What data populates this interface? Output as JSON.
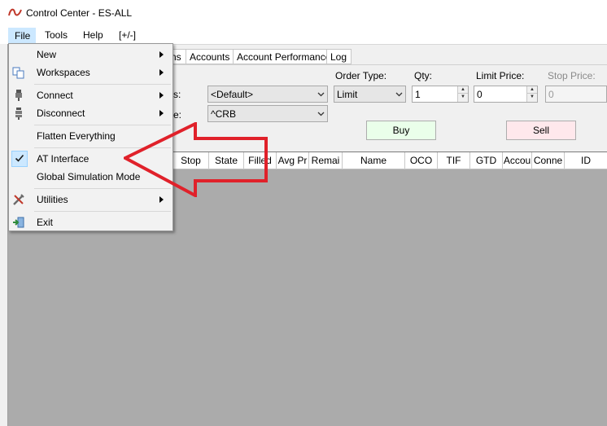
{
  "window": {
    "title": "Control Center - ES-ALL"
  },
  "menubar": {
    "file": "File",
    "tools": "Tools",
    "help": "Help",
    "toggle": "[+/-]"
  },
  "tabs": [
    "ns",
    "Accounts",
    "Account Performance",
    "Log"
  ],
  "order_panel": {
    "label_fragment_1": "s:",
    "label_fragment_2": "e:",
    "account_value": "<Default>",
    "instrument_value": "^CRB",
    "order_type_label": "Order Type:",
    "order_type_value": "Limit",
    "qty_label": "Qty:",
    "qty_value": "1",
    "limit_price_label": "Limit Price:",
    "limit_price_value": "0",
    "stop_price_label": "Stop Price:",
    "stop_price_value": "0",
    "buy_label": "Buy",
    "sell_label": "Sell",
    "buy_color": "#eaffea",
    "sell_color": "#ffe8ec"
  },
  "grid_columns": [
    "Stop",
    "State",
    "Filled",
    "Avg Pr",
    "Remai",
    "Name",
    "OCO",
    "TIF",
    "GTD",
    "Accou",
    "Conne",
    "ID"
  ],
  "file_menu": {
    "items": [
      {
        "label": "New",
        "icon": "",
        "submenu": true
      },
      {
        "label": "Workspaces",
        "icon": "copy-icon",
        "submenu": true
      },
      {
        "label": "Connect",
        "icon": "plug-icon",
        "submenu": true
      },
      {
        "label": "Disconnect",
        "icon": "unplug-icon",
        "submenu": true
      },
      {
        "label": "Flatten Everything",
        "icon": "",
        "submenu": false
      },
      {
        "label": "AT Interface",
        "icon": "checkmark-icon",
        "submenu": false,
        "checked": true
      },
      {
        "label": "Global Simulation Mode",
        "icon": "",
        "submenu": false
      },
      {
        "label": "Utilities",
        "icon": "tools-icon",
        "submenu": true
      },
      {
        "label": "Exit",
        "icon": "exit-icon",
        "submenu": false
      }
    ]
  },
  "annotation": {
    "arrow_color": "#e0212a",
    "arrow_points_to": "AT Interface"
  }
}
